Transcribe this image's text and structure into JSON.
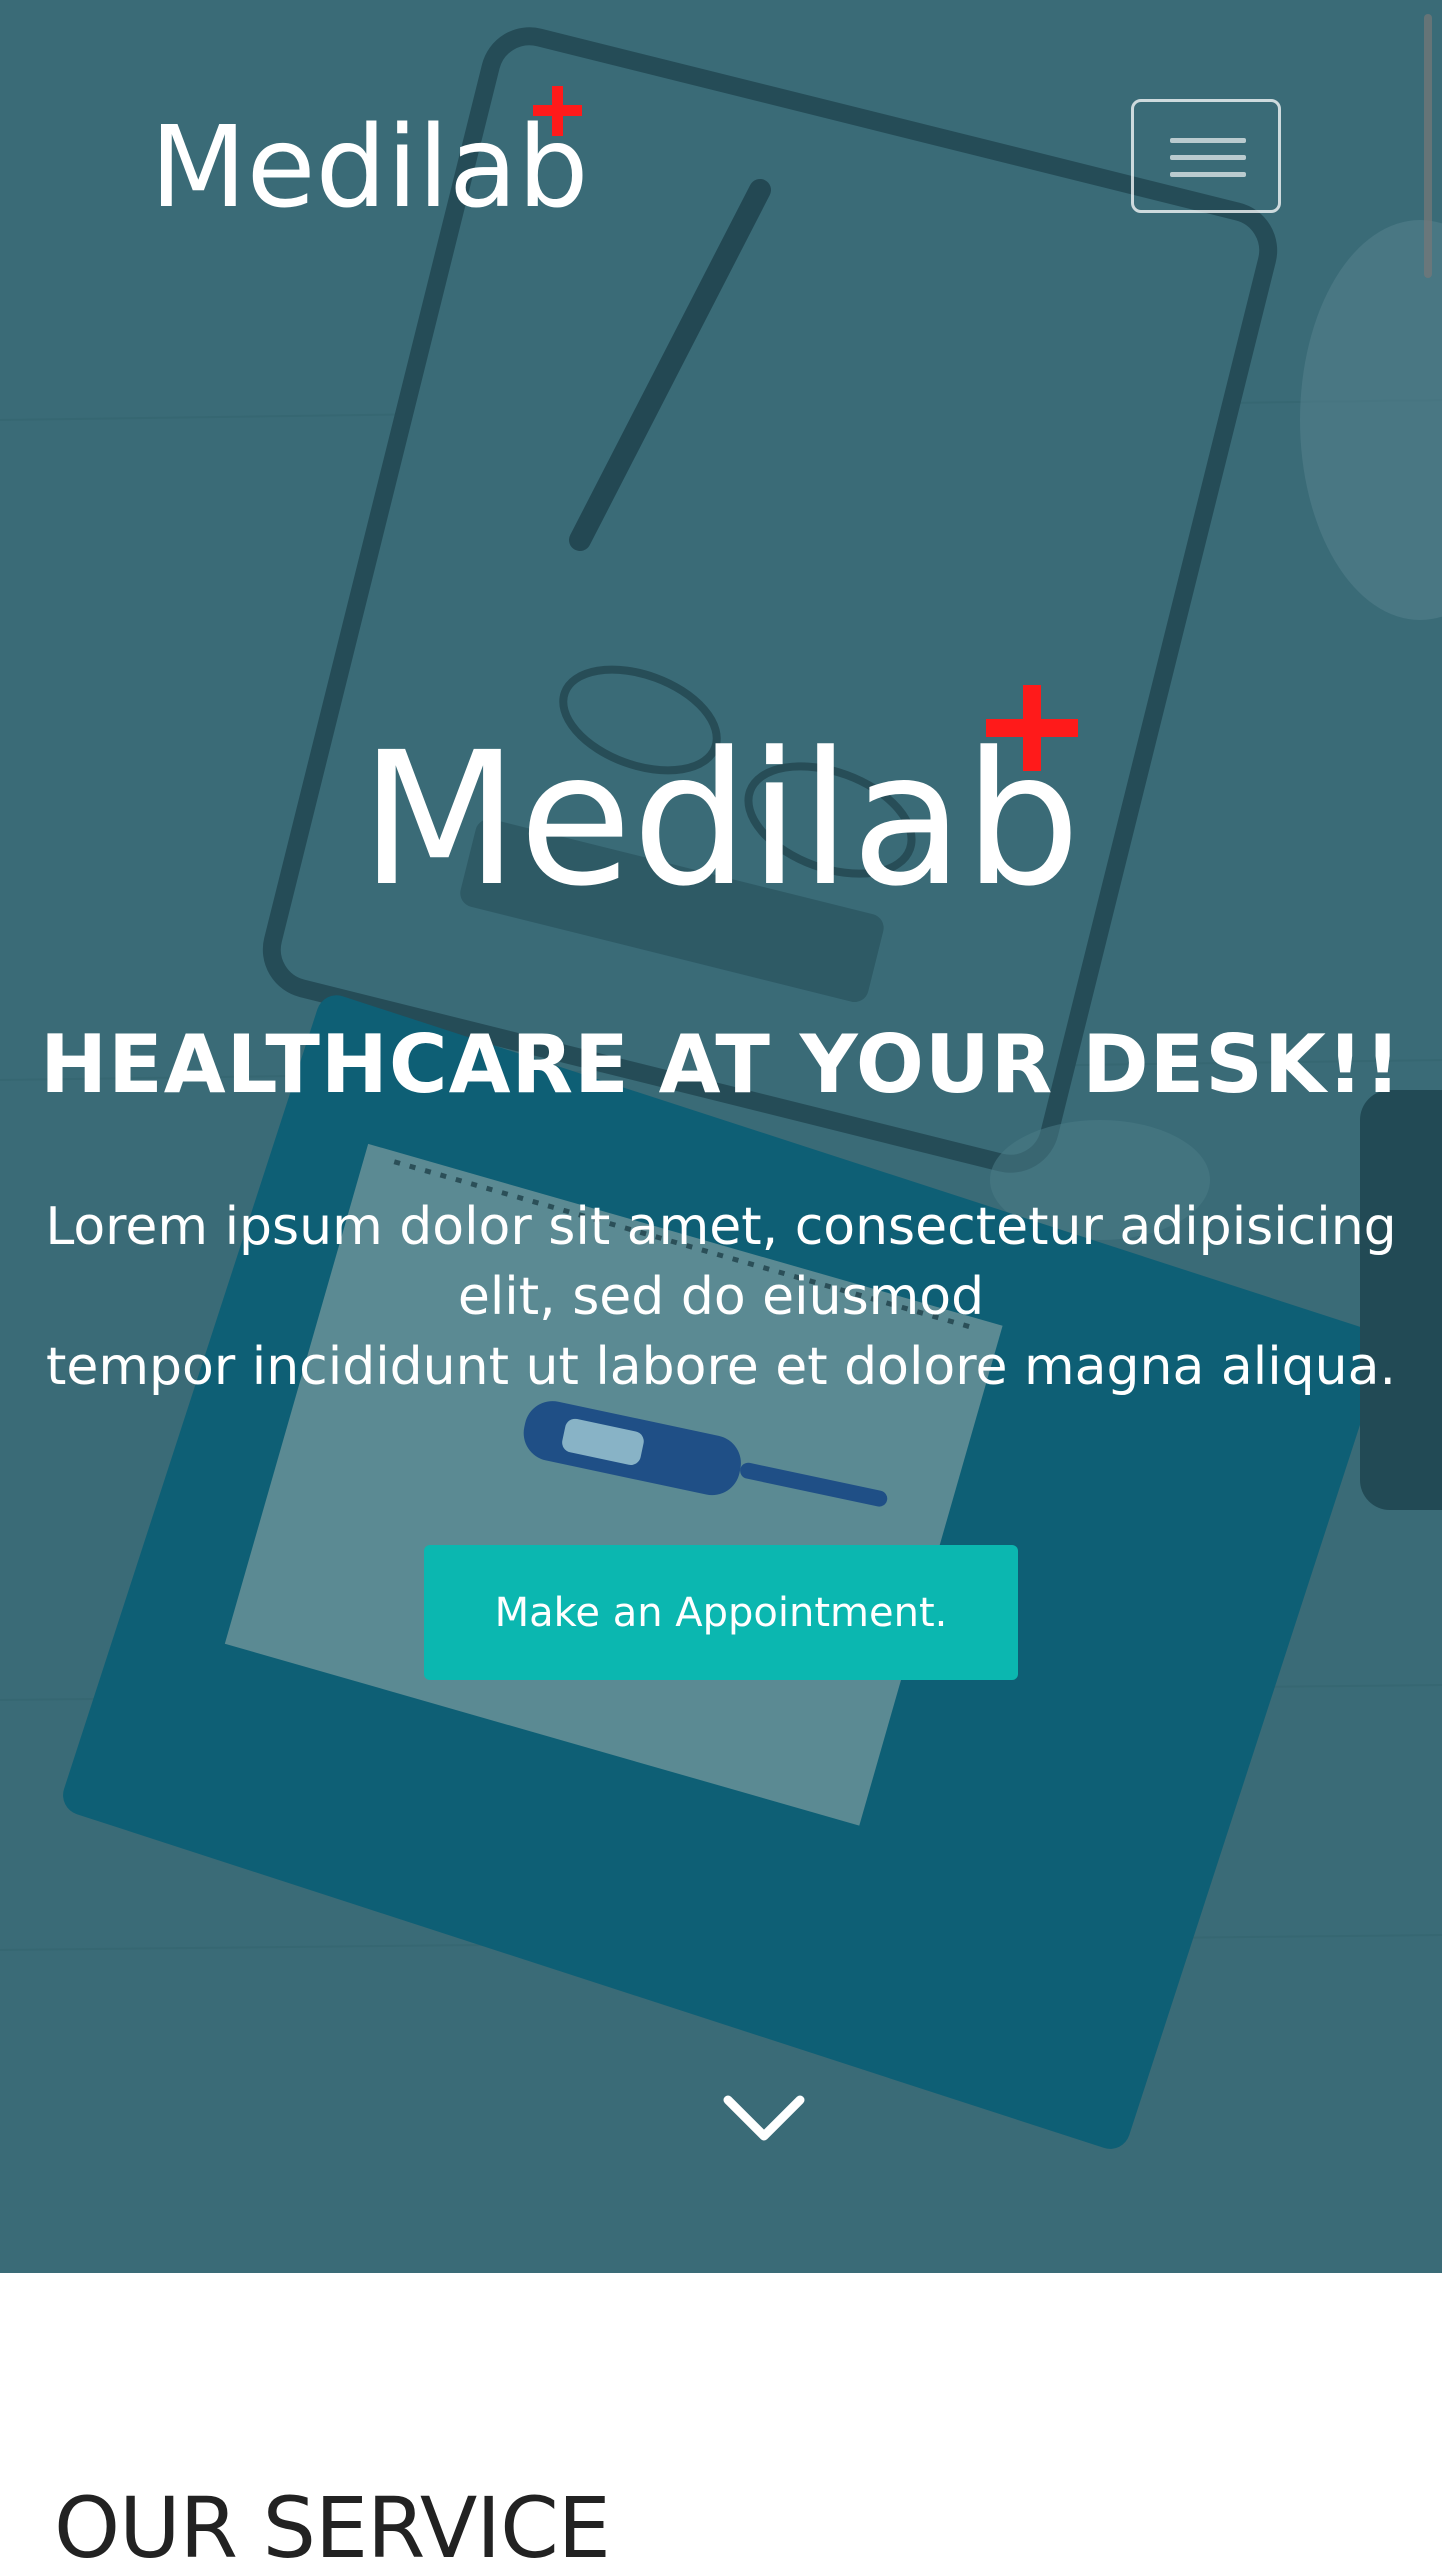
{
  "colors": {
    "hero_overlay": "#3d6e7a",
    "cta_background": "#0bb7b0",
    "logo_cross": "#ff0000",
    "text_light": "#ffffff",
    "section_heading": "#222222"
  },
  "brand": {
    "logo_text": "Medilab",
    "logo_mark": "red-plus-icon"
  },
  "navbar": {
    "menu_icon": "hamburger-icon"
  },
  "hero": {
    "title": "HEALTHCARE AT YOUR DESK!!",
    "description_line1": "Lorem ipsum dolor sit amet, consectetur adipisicing elit, sed do eiusmod",
    "description_line2": "tempor incididunt ut labore et dolore magna aliqua.",
    "cta_label": "Make an Appointment.",
    "scroll_icon": "chevron-down-icon"
  },
  "services": {
    "heading": "OUR SERVICE"
  }
}
